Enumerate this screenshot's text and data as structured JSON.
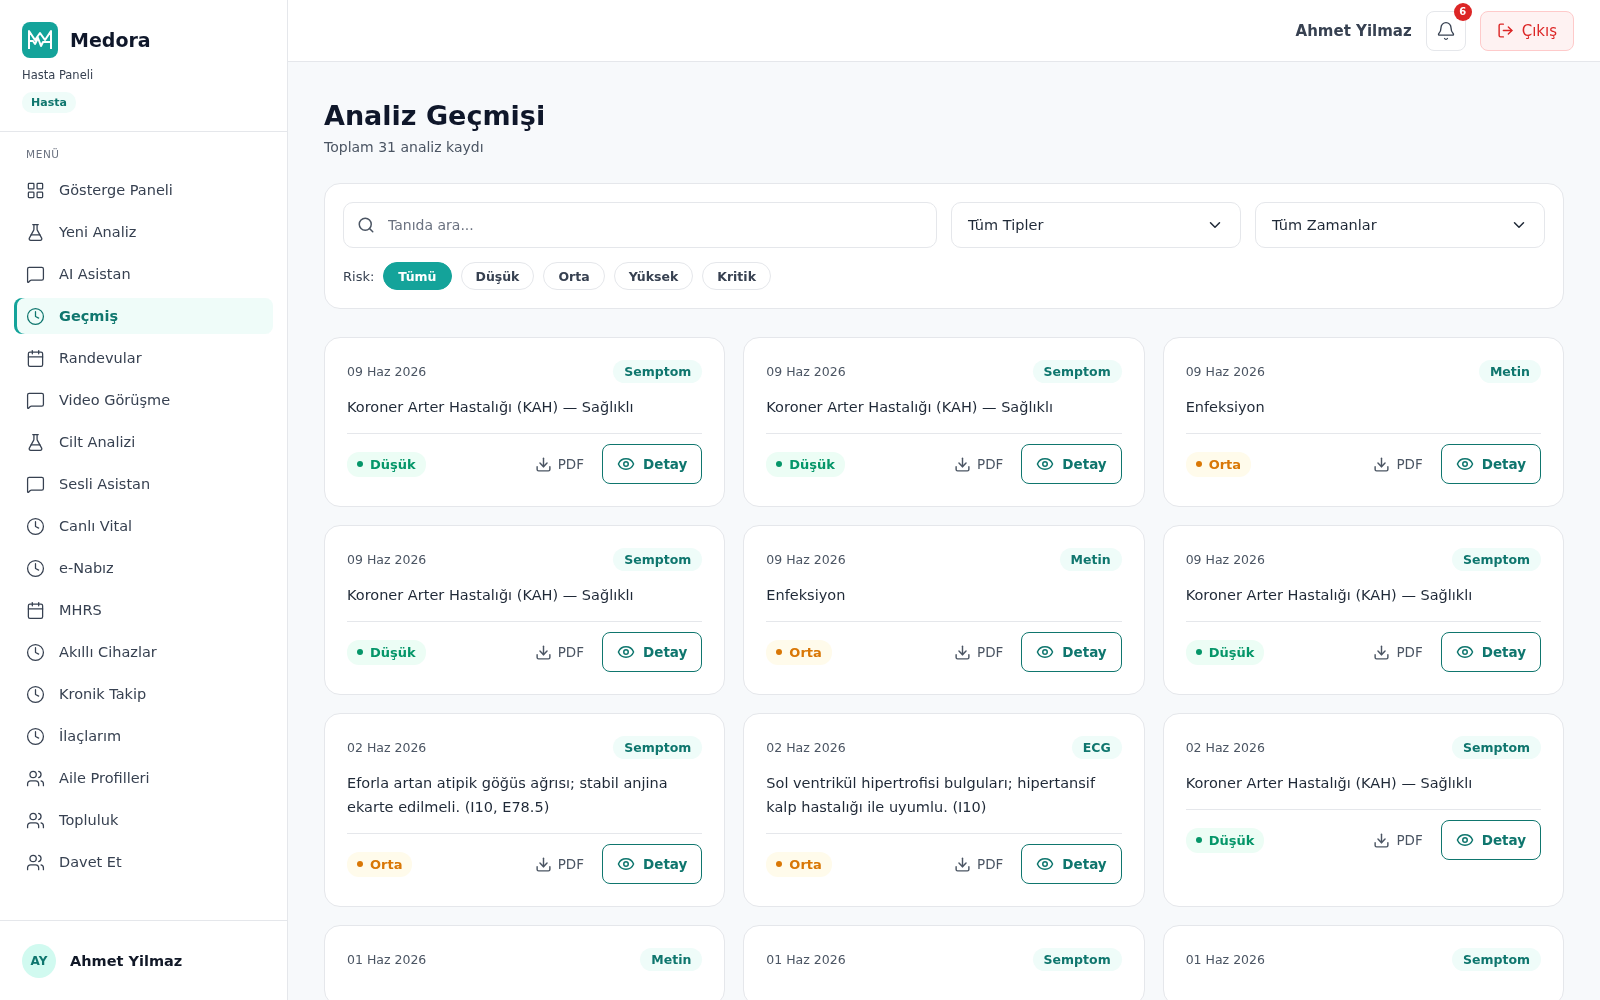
{
  "brand": {
    "name": "Medora",
    "subtitle": "Hasta Paneli",
    "role": "Hasta"
  },
  "menu": {
    "heading": "MENÜ",
    "items": [
      {
        "label": "Gösterge Paneli",
        "kind": "grid",
        "selected": false
      },
      {
        "label": "Yeni Analiz",
        "kind": "flask",
        "selected": false
      },
      {
        "label": "AI Asistan",
        "kind": "chat",
        "selected": false
      },
      {
        "label": "Geçmiş",
        "kind": "clock",
        "selected": true
      },
      {
        "label": "Randevular",
        "kind": "calendar",
        "selected": false
      },
      {
        "label": "Video Görüşme",
        "kind": "chat",
        "selected": false
      },
      {
        "label": "Cilt Analizi",
        "kind": "flask",
        "selected": false
      },
      {
        "label": "Sesli Asistan",
        "kind": "chat",
        "selected": false
      },
      {
        "label": "Canlı Vital",
        "kind": "clock",
        "selected": false
      },
      {
        "label": "e-Nabız",
        "kind": "clock",
        "selected": false
      },
      {
        "label": "MHRS",
        "kind": "calendar",
        "selected": false
      },
      {
        "label": "Akıllı Cihazlar",
        "kind": "clock",
        "selected": false
      },
      {
        "label": "Kronik Takip",
        "kind": "clock",
        "selected": false
      },
      {
        "label": "İlaçlarım",
        "kind": "clock",
        "selected": false
      },
      {
        "label": "Aile Profilleri",
        "kind": "users",
        "selected": false
      },
      {
        "label": "Topluluk",
        "kind": "users",
        "selected": false
      },
      {
        "label": "Davet Et",
        "kind": "users",
        "selected": false
      }
    ]
  },
  "sidebar_user": {
    "initials": "AY",
    "name": "Ahmet Yilmaz"
  },
  "header": {
    "user": "Ahmet Yilmaz",
    "notifications": "6",
    "logout": "Çıkış"
  },
  "page": {
    "title": "Analiz Geçmişi",
    "subtitle": "Toplam 31 analiz kaydı"
  },
  "filters": {
    "search": {
      "placeholder": "Tanıda ara..."
    },
    "type_select": "Tüm Tipler",
    "time_select": "Tüm Zamanlar",
    "risk_label": "Risk:",
    "risk_chips": [
      {
        "label": "Tümü",
        "selected": true
      },
      {
        "label": "Düşük",
        "selected": false
      },
      {
        "label": "Orta",
        "selected": false
      },
      {
        "label": "Yüksek",
        "selected": false
      },
      {
        "label": "Kritik",
        "selected": false
      }
    ]
  },
  "cards": [
    {
      "date": "09 Haz 2026",
      "tag": "Semptom",
      "title": "Koroner Arter Hastalığı (KAH) — Sağlıklı",
      "risk": {
        "label": "Düşük",
        "kind": "low"
      },
      "pdf": "PDF",
      "detail": "Detay"
    },
    {
      "date": "09 Haz 2026",
      "tag": "Semptom",
      "title": "Koroner Arter Hastalığı (KAH) — Sağlıklı",
      "risk": {
        "label": "Düşük",
        "kind": "low"
      },
      "pdf": "PDF",
      "detail": "Detay"
    },
    {
      "date": "09 Haz 2026",
      "tag": "Metin",
      "title": "Enfeksiyon",
      "risk": {
        "label": "Orta",
        "kind": "medium"
      },
      "pdf": "PDF",
      "detail": "Detay"
    },
    {
      "date": "09 Haz 2026",
      "tag": "Semptom",
      "title": "Koroner Arter Hastalığı (KAH) — Sağlıklı",
      "risk": {
        "label": "Düşük",
        "kind": "low"
      },
      "pdf": "PDF",
      "detail": "Detay"
    },
    {
      "date": "09 Haz 2026",
      "tag": "Metin",
      "title": "Enfeksiyon",
      "risk": {
        "label": "Orta",
        "kind": "medium"
      },
      "pdf": "PDF",
      "detail": "Detay"
    },
    {
      "date": "09 Haz 2026",
      "tag": "Semptom",
      "title": "Koroner Arter Hastalığı (KAH) — Sağlıklı",
      "risk": {
        "label": "Düşük",
        "kind": "low"
      },
      "pdf": "PDF",
      "detail": "Detay"
    },
    {
      "date": "02 Haz 2026",
      "tag": "Semptom",
      "title": "Eforla artan atipik göğüs ağrısı; stabil anjina ekarte edilmeli. (I10, E78.5)",
      "risk": {
        "label": "Orta",
        "kind": "medium"
      },
      "pdf": "PDF",
      "detail": "Detay"
    },
    {
      "date": "02 Haz 2026",
      "tag": "ECG",
      "title": "Sol ventrikül hipertrofisi bulguları; hipertansif kalp hastalığı ile uyumlu. (I10)",
      "risk": {
        "label": "Orta",
        "kind": "medium"
      },
      "pdf": "PDF",
      "detail": "Detay"
    },
    {
      "date": "02 Haz 2026",
      "tag": "Semptom",
      "title": "Koroner Arter Hastalığı (KAH) — Sağlıklı",
      "risk": {
        "label": "Düşük",
        "kind": "low"
      },
      "pdf": "PDF",
      "detail": "Detay"
    },
    {
      "date": "01 Haz 2026",
      "tag": "Metin"
    },
    {
      "date": "01 Haz 2026",
      "tag": "Semptom"
    },
    {
      "date": "01 Haz 2026",
      "tag": "Semptom"
    }
  ]
}
